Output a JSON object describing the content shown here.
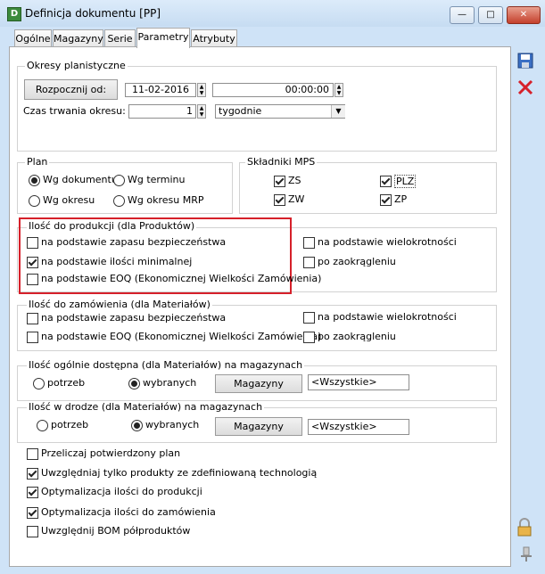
{
  "window": {
    "title": "Definicja dokumentu [PP]",
    "min": "—",
    "max": "□",
    "close": "✕"
  },
  "tabs": [
    "Ogólne",
    "Magazyny",
    "Serie",
    "Parametry",
    "Atrybuty"
  ],
  "okresy": {
    "label": "Okresy planistyczne",
    "start_button": "Rozpocznij od:",
    "date": "11-02-2016",
    "time": "00:00:00",
    "duration_label": "Czas trwania okresu:",
    "duration_value": "1",
    "unit": "tygodnie"
  },
  "plan": {
    "label": "Plan",
    "options": [
      "Wg dokumentu",
      "Wg terminu",
      "Wg okresu",
      "Wg okresu MRP"
    ],
    "selected": 0
  },
  "mps": {
    "label": "Składniki MPS",
    "items": [
      {
        "label": "ZS",
        "checked": true
      },
      {
        "label": "PLZ",
        "checked": true
      },
      {
        "label": "ZW",
        "checked": true
      },
      {
        "label": "ZP",
        "checked": true
      }
    ]
  },
  "produkcja": {
    "label": "Ilość do produkcji (dla Produktów)",
    "left": [
      {
        "label": "na podstawie zapasu bezpieczeństwa",
        "checked": false
      },
      {
        "label": "na podstawie ilości minimalnej",
        "checked": true
      },
      {
        "label": "na podstawie EOQ (Ekonomicznej Wielkości Zamówienia)",
        "checked": false
      }
    ],
    "right": [
      {
        "label": "na podstawie wielokrotności",
        "checked": false
      },
      {
        "label": "po zaokrągleniu",
        "checked": false
      }
    ]
  },
  "zamowienia": {
    "label": "Ilość do zamówienia (dla Materiałów)",
    "left": [
      {
        "label": "na podstawie zapasu bezpieczeństwa",
        "checked": false
      },
      {
        "label": "na podstawie EOQ (Ekonomicznej Wielkości Zamówienia)",
        "checked": false
      }
    ],
    "right": [
      {
        "label": "na podstawie wielokrotności",
        "checked": false
      },
      {
        "label": "po zaokrągleniu",
        "checked": false
      }
    ]
  },
  "dostepna": {
    "label": "Ilość ogólnie dostępna (dla Materiałów) na magazynach",
    "opt1": "potrzeb",
    "opt2": "wybranych",
    "selected": 1,
    "button": "Magazyny",
    "value": "<Wszystkie>"
  },
  "wdrodze": {
    "label": "Ilość w drodze (dla Materiałów) na magazynach",
    "opt1": "potrzeb",
    "opt2": "wybranych",
    "selected": 1,
    "button": "Magazyny",
    "value": "<Wszystkie>"
  },
  "options": [
    {
      "label": "Przeliczaj potwierdzony plan",
      "checked": false
    },
    {
      "label": "Uwzględniaj tylko produkty ze zdefiniowaną technologią",
      "checked": true
    },
    {
      "label": "Optymalizacja ilości do produkcji",
      "checked": true
    },
    {
      "label": "Optymalizacja ilości do zamówienia",
      "checked": true
    },
    {
      "label": "Uwzględnij BOM półproduktów",
      "checked": false
    }
  ],
  "colors": {
    "accent_red": "#d6202a",
    "frame": "#cfe3f7"
  }
}
